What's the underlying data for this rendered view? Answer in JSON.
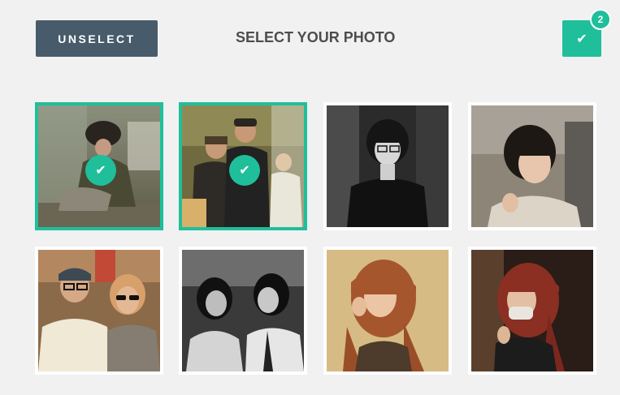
{
  "header": {
    "unselect_label": "UNSELECT",
    "title": "SELECT YOUR PHOTO",
    "confirm_icon": "check-icon",
    "selected_count": "2"
  },
  "colors": {
    "accent": "#1fbf9b",
    "button_dark": "#475b6b",
    "background": "#f1f1f1"
  },
  "photos": [
    {
      "subject": "person in fur hat crouching on street",
      "selected": true,
      "check": "✔"
    },
    {
      "subject": "two young men standing on street",
      "selected": true,
      "check": "✔"
    },
    {
      "subject": "woman with bob haircut and glasses",
      "selected": false,
      "check": ""
    },
    {
      "subject": "woman with short dark hair",
      "selected": false,
      "check": ""
    },
    {
      "subject": "couple with cap and sunglasses",
      "selected": false,
      "check": ""
    },
    {
      "subject": "two women in crowd",
      "selected": false,
      "check": ""
    },
    {
      "subject": "woman with long auburn hair",
      "selected": false,
      "check": ""
    },
    {
      "subject": "woman with red hair wearing mask",
      "selected": false,
      "check": ""
    }
  ]
}
